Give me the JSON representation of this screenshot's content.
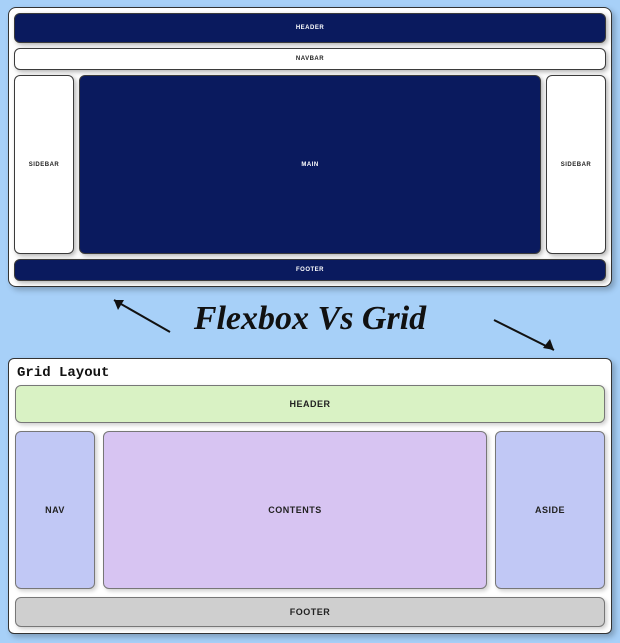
{
  "title": "Flexbox Vs Grid",
  "flexbox": {
    "header": "HEADER",
    "navbar": "NAVBAR",
    "sidebar_left": "SIDEBAR",
    "main": "MAIN",
    "sidebar_right": "SIDEBAR",
    "footer": "FOOTER"
  },
  "grid": {
    "title": "Grid Layout",
    "header": "HEADER",
    "nav": "NAV",
    "contents": "CONTENTS",
    "aside": "ASIDE",
    "footer": "FOOTER"
  },
  "colors": {
    "page_bg": "#a7d0f8",
    "flex_dark": "#0a1a5e",
    "grid_header": "#d9f2c4",
    "grid_nav": "#c1c8f5",
    "grid_contents": "#d7c4f2",
    "grid_aside": "#c1c8f5",
    "grid_footer": "#cfcfcf"
  }
}
